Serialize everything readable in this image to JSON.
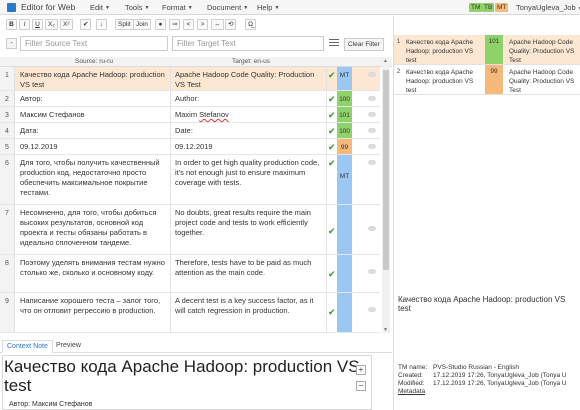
{
  "app": {
    "title": "Editor for Web"
  },
  "menu": [
    {
      "label": "Edit"
    },
    {
      "label": "Tools"
    },
    {
      "label": "Format"
    },
    {
      "label": "Document"
    },
    {
      "label": "Help"
    }
  ],
  "header": {
    "badges": [
      {
        "label": "TM",
        "color": "#8fd16a"
      },
      {
        "label": "TB",
        "color": "#8fd16a"
      },
      {
        "label": "MT",
        "color": "#f5b97b"
      }
    ],
    "user": "TonyaUgleva_Job"
  },
  "toolbar": {
    "bold": "B",
    "italic": "I",
    "underline": "U",
    "subscript": "X₂",
    "superscript": "X²",
    "split": "Split",
    "join": "Join",
    "special_chars": "Ω̲"
  },
  "filter": {
    "source_placeholder": "Filter Source Text",
    "target_placeholder": "Filter Target Text",
    "clear_label": "Clear Filter"
  },
  "grid": {
    "source_header": "Source: ru-ru",
    "target_header": "Target: en-us",
    "rows": [
      {
        "num": "1",
        "source": "Качество кода Apache Hadoop: production VS test",
        "target": "Apache Hadoop Code Quality: Production VS Test",
        "match": "MT",
        "match_color": "#9ac8f3"
      },
      {
        "num": "2",
        "source": "Автор:",
        "target": "Author:",
        "match": "100",
        "match_color": "#8fd16a"
      },
      {
        "num": "3",
        "source": "Максим Стефанов",
        "target_pre": "Maxim ",
        "target_err": "Stefanov",
        "match": "101",
        "match_color": "#8fd16a"
      },
      {
        "num": "4",
        "source": "Дата:",
        "target": "Date:",
        "match": "100",
        "match_color": "#8fd16a"
      },
      {
        "num": "5",
        "source": "09.12.2019",
        "target": "09.12.2019",
        "match": "99",
        "match_color": "#f5b97b"
      },
      {
        "num": "6",
        "source": "Для того, чтобы получить качественный production код, недостаточно просто обеспечить максимальное покрытие тестами.",
        "target": "In order to get high quality production code, it's not enough just to ensure maximum coverage with tests.",
        "match": "MT",
        "match_color": "#9ac8f3"
      },
      {
        "num": "7",
        "source": "Несомненно, для того, чтобы добиться высоких результатов, основной код проекта и тесты обязаны работать в идеально сплоченном тандеме.",
        "target": "No doubts, great results require the main project code and tests to work efficiently together.",
        "match": "",
        "match_color": "#9ac8f3"
      },
      {
        "num": "8",
        "source": "Поэтому уделять внимания тестам нужно столько же, сколько и основному коду.",
        "target": "Therefore, tests have to be paid as much attention as the main code.",
        "match": "",
        "match_color": "#9ac8f3"
      },
      {
        "num": "9",
        "source": "Написание хорошего теста – залог того, что он отловит регрессию в production.",
        "target": "A decent test is a key success factor, as it will catch regression in production.",
        "match": "",
        "match_color": "#9ac8f3"
      }
    ]
  },
  "bottom": {
    "tab_context": "Context Note",
    "tab_preview": "Preview",
    "context_text": "Качество кода Apache Hadoop: production VS test",
    "context_author": "Автор: Максим Стефанов",
    "zoom_in": "+",
    "zoom_out": "−"
  },
  "tm": {
    "matches": [
      {
        "num": "1",
        "source": "Качество кода Apache Hadoop: production VS test",
        "score": "101",
        "score_color": "#8fd16a",
        "target": "Apache Hadoop Code Quality: Production VS Test"
      },
      {
        "num": "2",
        "source": "Качество кода Apache Hadoop: production VS test",
        "score": "99",
        "score_color": "#f5b97b",
        "target": "Apache Hadoop Code Quality: Production VS Test"
      }
    ],
    "source_preview": "Качество кода Apache Hadoop: production VS test",
    "info": {
      "tm_name_label": "TM name:",
      "tm_name": "PVS-Studio Russian - English",
      "created_label": "Created:",
      "created": "17.12.2019 17:26, TonyaUgleva_Job (Tonya U",
      "modified_label": "Modified:",
      "modified": "17.12.2019 17:26, TonyaUgleva_Job (Tonya U",
      "metadata": "Metadata"
    }
  }
}
